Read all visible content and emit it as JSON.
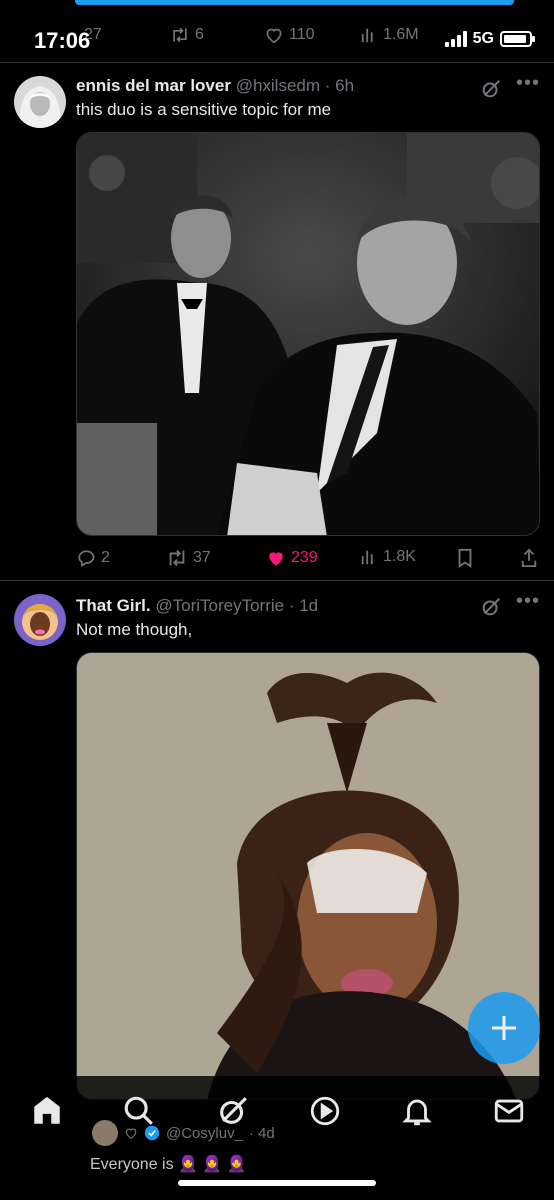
{
  "status_bar": {
    "time": "17:06",
    "network": "5G",
    "battery_level": 0.9
  },
  "prev_tweet_actions": {
    "replies": "27",
    "retweets": "6",
    "likes": "110",
    "views": "1.6M"
  },
  "tweets": [
    {
      "name": "ennis del mar lover",
      "handle": "@hxilsedm",
      "time": "· 6h",
      "text": "this duo is a sensitive topic for me",
      "actions": {
        "replies": "2",
        "retweets": "37",
        "likes": "239",
        "views": "1.8K"
      }
    },
    {
      "name": "That Girl.",
      "handle": "@ToriToreyTorrie",
      "time": "· 1d",
      "text": "Not me though,"
    }
  ],
  "reply_preview": {
    "handle": "@Cosyluv_",
    "time": "· 4d",
    "text": "Everyone is 🧕 🧕 🧕"
  },
  "icons": [
    "reply-icon",
    "retweet-icon",
    "heart-icon",
    "views-icon",
    "bookmark-icon",
    "share-icon",
    "grok-icon",
    "more-icon",
    "home-icon",
    "search-icon",
    "video-icon",
    "bell-icon",
    "mail-icon",
    "compose-icon"
  ],
  "colors": {
    "accent": "#1d9bf0",
    "like": "#f91880",
    "muted": "#71767b",
    "background": "#000000"
  }
}
